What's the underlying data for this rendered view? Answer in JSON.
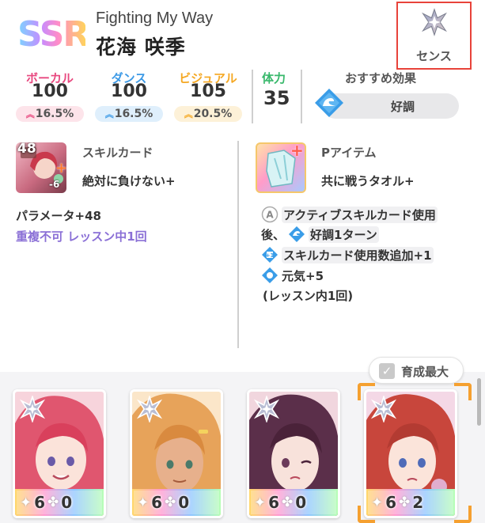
{
  "header": {
    "rarity": "SSR",
    "card_title": "Fighting My Way",
    "idol_name": "花海 咲季",
    "plan_label": "センス"
  },
  "stats": {
    "vocal": {
      "label": "ボーカル",
      "value": "100",
      "bonus": "16.5%"
    },
    "dance": {
      "label": "ダンス",
      "value": "100",
      "bonus": "16.5%"
    },
    "visual": {
      "label": "ビジュアル",
      "value": "105",
      "bonus": "20.5%"
    },
    "stamina": {
      "label": "体力",
      "value": "35"
    }
  },
  "recommended": {
    "label": "おすすめ効果",
    "value": "好調"
  },
  "skill_card": {
    "section_label": "スキルカード",
    "name": "絶対に負けない+",
    "cost": "48",
    "cost_badge": "-6",
    "effect": "パラメータ+48",
    "note": "重複不可 レッスン中1回"
  },
  "p_item": {
    "section_label": "Pアイテム",
    "name": "共に戦うタオル+",
    "effect_lines": [
      "アクティブスキルカード使用",
      "後、",
      "好調1ターン",
      "スキルカード使用数追加+1",
      "元気+5",
      "(レッスン内1回)"
    ]
  },
  "growth_max": {
    "label": "育成最大"
  },
  "cards": [
    {
      "level": "6",
      "count": "0"
    },
    {
      "level": "6",
      "count": "0"
    },
    {
      "level": "6",
      "count": "0"
    },
    {
      "level": "6",
      "count": "2"
    }
  ],
  "colors": {
    "vocal": "#e8487f",
    "dance": "#3d9ae6",
    "visual": "#f5a823",
    "stamina": "#38b86b",
    "selection": "#f5a030",
    "highlight_border": "#e8433a"
  }
}
